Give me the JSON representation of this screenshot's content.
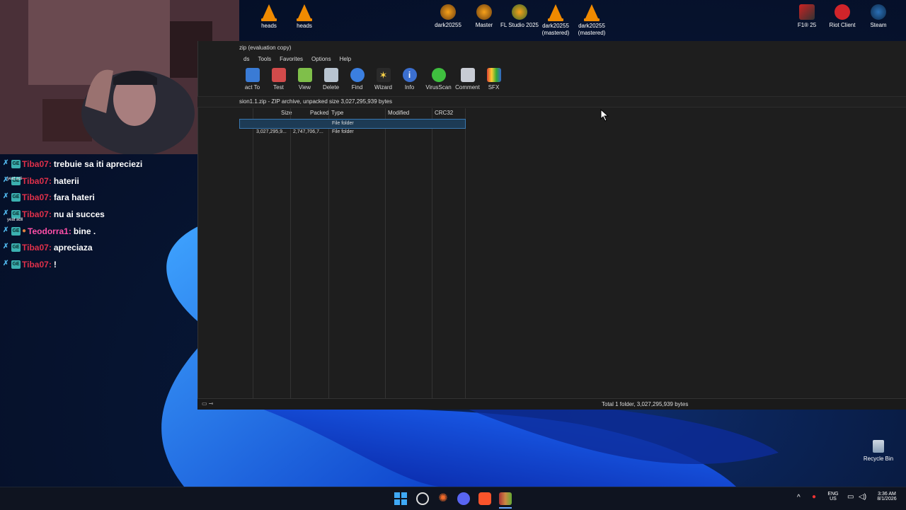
{
  "desktop": {
    "icons": [
      {
        "label": "heads",
        "icon": "vlc-icon"
      },
      {
        "label": "heads",
        "icon": "vlc-icon"
      },
      {
        "label": "dark20255",
        "icon": "fl-studio-icon"
      },
      {
        "label": "Master",
        "icon": "fl-studio-icon"
      },
      {
        "label": "FL Studio 2025",
        "icon": "fl-studio-icon"
      },
      {
        "label": "dark20255 (mastered)",
        "icon": "vlc-icon"
      },
      {
        "label": "dark20255 (mastered)",
        "icon": "vlc-icon"
      },
      {
        "label": "F1® 25",
        "icon": "f1-game-icon"
      },
      {
        "label": "Riot Client",
        "icon": "riot-client-icon"
      },
      {
        "label": "Steam",
        "icon": "steam-icon"
      }
    ],
    "recycle_bin": "Recycle Bin"
  },
  "chat": {
    "messages": [
      {
        "user": "Tiba07",
        "message": "trebuie sa iti apreciezi",
        "color": "#e0304a"
      },
      {
        "user": "Tiba07",
        "message": "haterii",
        "color": "#e0304a"
      },
      {
        "user": "Tiba07",
        "message": "fara hateri",
        "color": "#e0304a"
      },
      {
        "user": "Tiba07",
        "message": "nu ai succes",
        "color": "#e0304a"
      },
      {
        "user": "Teodorra1",
        "message": "bine .",
        "color": "#ff4fa8"
      },
      {
        "user": "Tiba07",
        "message": "apreciaza",
        "color": "#e0304a"
      },
      {
        "user": "Tiba07",
        "message": "!",
        "color": "#e0304a"
      }
    ],
    "sticker_texts": [
      "yeat adi",
      "yeat adll"
    ]
  },
  "winrar": {
    "title": "zip (evaluation copy)",
    "menu": [
      "ds",
      "Tools",
      "Favorites",
      "Options",
      "Help"
    ],
    "toolbar": [
      {
        "label": "act To",
        "icon": "extract-icon"
      },
      {
        "label": "Test",
        "icon": "test-icon"
      },
      {
        "label": "View",
        "icon": "view-icon"
      },
      {
        "label": "Delete",
        "icon": "delete-icon"
      },
      {
        "label": "Find",
        "icon": "find-icon"
      },
      {
        "label": "Wizard",
        "icon": "wizard-icon"
      },
      {
        "label": "Info",
        "icon": "info-icon"
      },
      {
        "label": "VirusScan",
        "icon": "virusscan-icon"
      },
      {
        "label": "Comment",
        "icon": "comment-icon"
      },
      {
        "label": "SFX",
        "icon": "sfx-icon"
      }
    ],
    "path_text": "sion1.1.zip - ZIP archive, unpacked size 3,027,295,939 bytes",
    "columns": [
      "Size",
      "Packed",
      "Type",
      "Modified",
      "CRC32"
    ],
    "rows": [
      {
        "size": "",
        "packed": "",
        "type": "File folder",
        "modified": "",
        "crc32": ""
      },
      {
        "size": "3,027,295,9...",
        "packed": "2,747,706,7...",
        "type": "File folder",
        "modified": "",
        "crc32": ""
      }
    ],
    "status": "Total 1 folder, 3,027,295,939 bytes"
  },
  "taskbar": {
    "language": "ENG",
    "region": "US",
    "time": "3:36 AM",
    "date": "8/1/2026"
  }
}
